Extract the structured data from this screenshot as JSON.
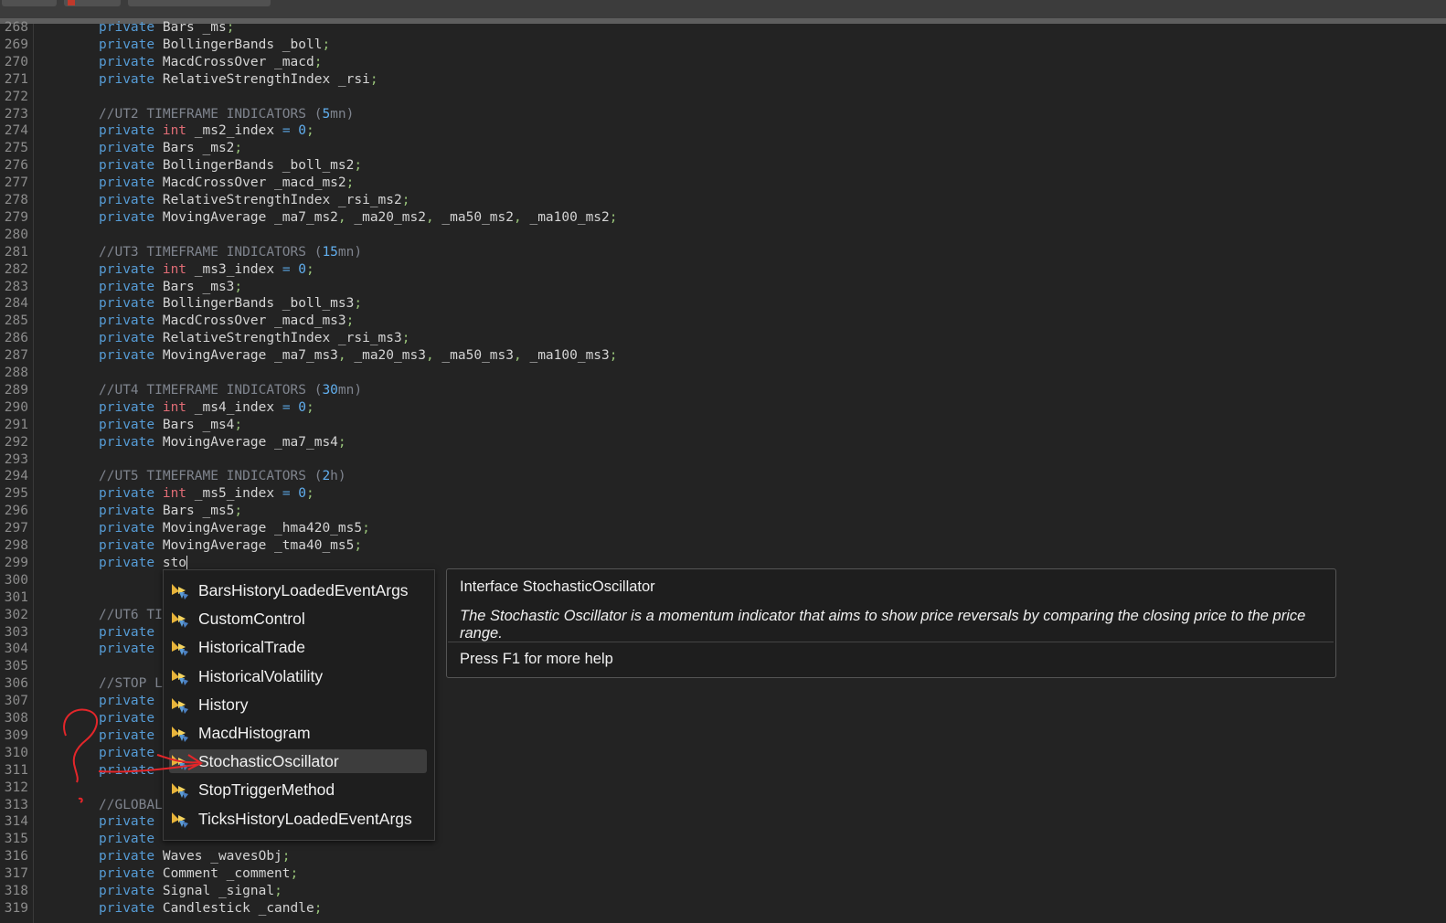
{
  "editor": {
    "lines": [
      {
        "num": "268",
        "segments": [
          [
            "kw",
            "private "
          ],
          [
            "",
            "Bars _ms"
          ],
          [
            "pc",
            ";"
          ]
        ]
      },
      {
        "num": "269",
        "segments": [
          [
            "kw",
            "private "
          ],
          [
            "",
            "BollingerBands _boll"
          ],
          [
            "pc",
            ";"
          ]
        ]
      },
      {
        "num": "270",
        "segments": [
          [
            "kw",
            "private "
          ],
          [
            "",
            "MacdCrossOver _macd"
          ],
          [
            "pc",
            ";"
          ]
        ]
      },
      {
        "num": "271",
        "segments": [
          [
            "kw",
            "private "
          ],
          [
            "",
            "RelativeStrengthIndex _rsi"
          ],
          [
            "pc",
            ";"
          ]
        ]
      },
      {
        "num": "272",
        "segments": []
      },
      {
        "num": "273",
        "segments": [
          [
            "cm",
            "//UT2 TIMEFRAME INDICATORS ("
          ],
          [
            "nm",
            "5"
          ],
          [
            "cm",
            "mn)"
          ]
        ]
      },
      {
        "num": "274",
        "segments": [
          [
            "kw",
            "private "
          ],
          [
            "ty",
            "int"
          ],
          [
            "",
            " _ms2_index "
          ],
          [
            "kw",
            "="
          ],
          [
            "",
            " "
          ],
          [
            "nm",
            "0"
          ],
          [
            "pc",
            ";"
          ]
        ]
      },
      {
        "num": "275",
        "segments": [
          [
            "kw",
            "private "
          ],
          [
            "",
            "Bars _ms2"
          ],
          [
            "pc",
            ";"
          ]
        ]
      },
      {
        "num": "276",
        "segments": [
          [
            "kw",
            "private "
          ],
          [
            "",
            "BollingerBands _boll_ms2"
          ],
          [
            "pc",
            ";"
          ]
        ]
      },
      {
        "num": "277",
        "segments": [
          [
            "kw",
            "private "
          ],
          [
            "",
            "MacdCrossOver _macd_ms2"
          ],
          [
            "pc",
            ";"
          ]
        ]
      },
      {
        "num": "278",
        "segments": [
          [
            "kw",
            "private "
          ],
          [
            "",
            "RelativeStrengthIndex _rsi_ms2"
          ],
          [
            "pc",
            ";"
          ]
        ]
      },
      {
        "num": "279",
        "segments": [
          [
            "kw",
            "private "
          ],
          [
            "",
            "MovingAverage _ma7_ms2"
          ],
          [
            "pc",
            ","
          ],
          [
            "",
            " _ma20_ms2"
          ],
          [
            "pc",
            ","
          ],
          [
            "",
            " _ma50_ms2"
          ],
          [
            "pc",
            ","
          ],
          [
            "",
            " _ma100_ms2"
          ],
          [
            "pc",
            ";"
          ]
        ]
      },
      {
        "num": "280",
        "segments": []
      },
      {
        "num": "281",
        "segments": [
          [
            "cm",
            "//UT3 TIMEFRAME INDICATORS ("
          ],
          [
            "nm",
            "15"
          ],
          [
            "cm",
            "mn)"
          ]
        ]
      },
      {
        "num": "282",
        "segments": [
          [
            "kw",
            "private "
          ],
          [
            "ty",
            "int"
          ],
          [
            "",
            " _ms3_index "
          ],
          [
            "kw",
            "="
          ],
          [
            "",
            " "
          ],
          [
            "nm",
            "0"
          ],
          [
            "pc",
            ";"
          ]
        ]
      },
      {
        "num": "283",
        "segments": [
          [
            "kw",
            "private "
          ],
          [
            "",
            "Bars _ms3"
          ],
          [
            "pc",
            ";"
          ]
        ]
      },
      {
        "num": "284",
        "segments": [
          [
            "kw",
            "private "
          ],
          [
            "",
            "BollingerBands _boll_ms3"
          ],
          [
            "pc",
            ";"
          ]
        ]
      },
      {
        "num": "285",
        "segments": [
          [
            "kw",
            "private "
          ],
          [
            "",
            "MacdCrossOver _macd_ms3"
          ],
          [
            "pc",
            ";"
          ]
        ]
      },
      {
        "num": "286",
        "segments": [
          [
            "kw",
            "private "
          ],
          [
            "",
            "RelativeStrengthIndex _rsi_ms3"
          ],
          [
            "pc",
            ";"
          ]
        ]
      },
      {
        "num": "287",
        "segments": [
          [
            "kw",
            "private "
          ],
          [
            "",
            "MovingAverage _ma7_ms3"
          ],
          [
            "pc",
            ","
          ],
          [
            "",
            " _ma20_ms3"
          ],
          [
            "pc",
            ","
          ],
          [
            "",
            " _ma50_ms3"
          ],
          [
            "pc",
            ","
          ],
          [
            "",
            " _ma100_ms3"
          ],
          [
            "pc",
            ";"
          ]
        ]
      },
      {
        "num": "288",
        "segments": []
      },
      {
        "num": "289",
        "segments": [
          [
            "cm",
            "//UT4 TIMEFRAME INDICATORS ("
          ],
          [
            "nm",
            "30"
          ],
          [
            "cm",
            "mn)"
          ]
        ]
      },
      {
        "num": "290",
        "segments": [
          [
            "kw",
            "private "
          ],
          [
            "ty",
            "int"
          ],
          [
            "",
            " _ms4_index "
          ],
          [
            "kw",
            "="
          ],
          [
            "",
            " "
          ],
          [
            "nm",
            "0"
          ],
          [
            "pc",
            ";"
          ]
        ]
      },
      {
        "num": "291",
        "segments": [
          [
            "kw",
            "private "
          ],
          [
            "",
            "Bars _ms4"
          ],
          [
            "pc",
            ";"
          ]
        ]
      },
      {
        "num": "292",
        "segments": [
          [
            "kw",
            "private "
          ],
          [
            "",
            "MovingAverage _ma7_ms4"
          ],
          [
            "pc",
            ";"
          ]
        ]
      },
      {
        "num": "293",
        "segments": []
      },
      {
        "num": "294",
        "segments": [
          [
            "cm",
            "//UT5 TIMEFRAME INDICATORS ("
          ],
          [
            "nm",
            "2"
          ],
          [
            "cm",
            "h)"
          ]
        ]
      },
      {
        "num": "295",
        "segments": [
          [
            "kw",
            "private "
          ],
          [
            "ty",
            "int"
          ],
          [
            "",
            " _ms5_index "
          ],
          [
            "kw",
            "="
          ],
          [
            "",
            " "
          ],
          [
            "nm",
            "0"
          ],
          [
            "pc",
            ";"
          ]
        ]
      },
      {
        "num": "296",
        "segments": [
          [
            "kw",
            "private "
          ],
          [
            "",
            "Bars _ms5"
          ],
          [
            "pc",
            ";"
          ]
        ]
      },
      {
        "num": "297",
        "segments": [
          [
            "kw",
            "private "
          ],
          [
            "",
            "MovingAverage _hma420_ms5"
          ],
          [
            "pc",
            ";"
          ]
        ]
      },
      {
        "num": "298",
        "segments": [
          [
            "kw",
            "private "
          ],
          [
            "",
            "MovingAverage _tma40_ms5"
          ],
          [
            "pc",
            ";"
          ]
        ]
      },
      {
        "num": "299",
        "segments": [
          [
            "kw",
            "private "
          ],
          [
            "",
            "sto"
          ]
        ],
        "cursor": true
      },
      {
        "num": "300",
        "segments": []
      },
      {
        "num": "301",
        "segments": []
      },
      {
        "num": "302",
        "segments": [
          [
            "cm",
            "//UT6 TI"
          ]
        ]
      },
      {
        "num": "303",
        "segments": [
          [
            "kw",
            "private"
          ]
        ]
      },
      {
        "num": "304",
        "segments": [
          [
            "kw",
            "private"
          ]
        ]
      },
      {
        "num": "305",
        "segments": []
      },
      {
        "num": "306",
        "segments": [
          [
            "cm",
            "//STOP L"
          ]
        ]
      },
      {
        "num": "307",
        "segments": [
          [
            "kw",
            "private"
          ]
        ]
      },
      {
        "num": "308",
        "segments": [
          [
            "kw",
            "private"
          ]
        ]
      },
      {
        "num": "309",
        "segments": [
          [
            "kw",
            "private"
          ]
        ]
      },
      {
        "num": "310",
        "segments": [
          [
            "kw",
            "private"
          ]
        ]
      },
      {
        "num": "311",
        "segments": [
          [
            "kw",
            "private"
          ]
        ]
      },
      {
        "num": "312",
        "segments": []
      },
      {
        "num": "313",
        "segments": [
          [
            "cm",
            "//GLOBAL"
          ]
        ]
      },
      {
        "num": "314",
        "segments": [
          [
            "kw",
            "private"
          ]
        ]
      },
      {
        "num": "315",
        "segments": [
          [
            "kw",
            "private"
          ]
        ]
      },
      {
        "num": "316",
        "segments": [
          [
            "kw",
            "private "
          ],
          [
            "",
            "Waves _wavesObj"
          ],
          [
            "pc",
            ";"
          ]
        ]
      },
      {
        "num": "317",
        "segments": [
          [
            "kw",
            "private "
          ],
          [
            "",
            "Comment _comment"
          ],
          [
            "pc",
            ";"
          ]
        ]
      },
      {
        "num": "318",
        "segments": [
          [
            "kw",
            "private "
          ],
          [
            "",
            "Signal _signal"
          ],
          [
            "pc",
            ";"
          ]
        ]
      },
      {
        "num": "319",
        "segments": [
          [
            "kw",
            "private "
          ],
          [
            "",
            "Candlestick _candle"
          ],
          [
            "pc",
            ";"
          ]
        ]
      }
    ]
  },
  "completion": {
    "icon": "class-member-icon",
    "selected_index": 6,
    "items": [
      "BarsHistoryLoadedEventArgs",
      "CustomControl",
      "HistoricalTrade",
      "HistoricalVolatility",
      "History",
      "MacdHistogram",
      "StochasticOscillator",
      "StopTriggerMethod",
      "TicksHistoryLoadedEventArgs"
    ]
  },
  "tooltip": {
    "title": "Interface StochasticOscillator",
    "description": "The Stochastic Oscillator is a momentum indicator that aims to show price reversals by comparing the closing price to the price range.",
    "help": "Press F1 for more help"
  },
  "colors": {
    "background": "#232323",
    "keyword": "#569cd6",
    "type": "#e06c75",
    "comment": "#7f848e",
    "number": "#61afef",
    "punctuation": "#98c379",
    "annotation": "#e3262a"
  }
}
